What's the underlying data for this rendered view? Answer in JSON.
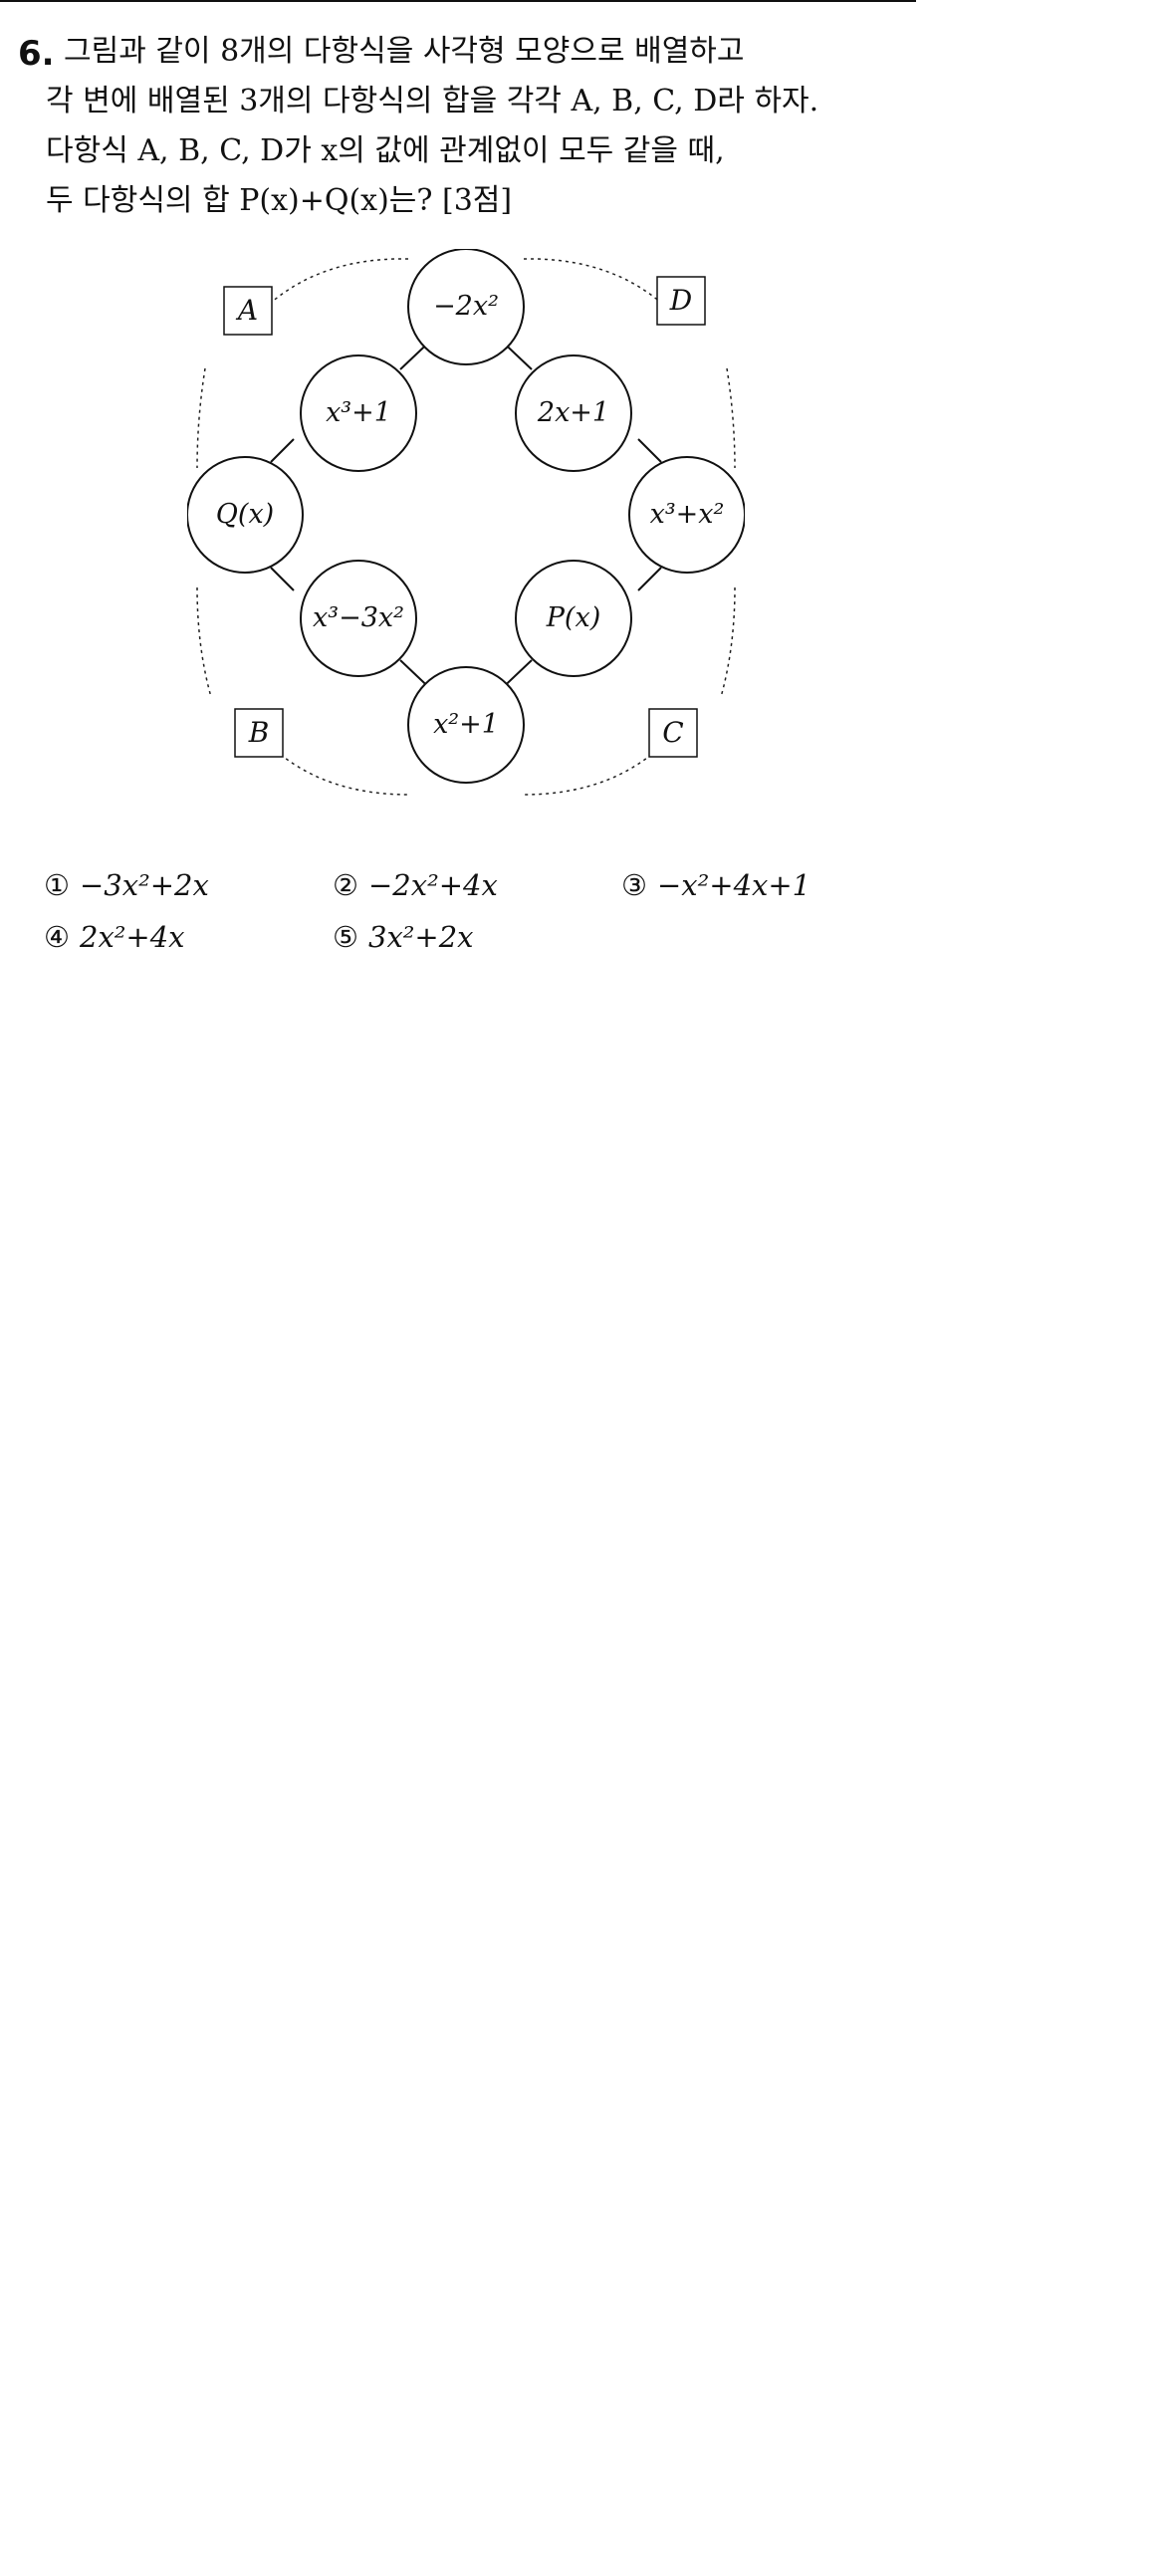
{
  "question": {
    "number": "6.",
    "lines": [
      "그림과 같이 8개의 다항식을 사각형 모양으로 배열하고",
      "각 변에 배열된 3개의 다항식의 합을 각각 A, B, C, D라 하자.",
      "다항식 A, B, C, D가 x의 값에 관계없이 모두 같을 때,",
      "두 다항식의 합 P(x)+Q(x)는? [3점]"
    ]
  },
  "figure": {
    "nodes": {
      "top": "−2x²",
      "upper_left": "x³+1",
      "upper_right": "2x+1",
      "left": "Q(x)",
      "right": "x³+x²",
      "lower_left": "x³−3x²",
      "lower_right": "P(x)",
      "bottom": "x²+1"
    },
    "corners": {
      "top_left": "A",
      "top_right": "D",
      "bottom_left": "B",
      "bottom_right": "C"
    }
  },
  "choices": [
    {
      "mark": "①",
      "expr": "−3x²+2x"
    },
    {
      "mark": "②",
      "expr": "−2x²+4x"
    },
    {
      "mark": "③",
      "expr": "−x²+4x+1"
    },
    {
      "mark": "④",
      "expr": "2x²+4x"
    },
    {
      "mark": "⑤",
      "expr": "3x²+2x"
    }
  ]
}
